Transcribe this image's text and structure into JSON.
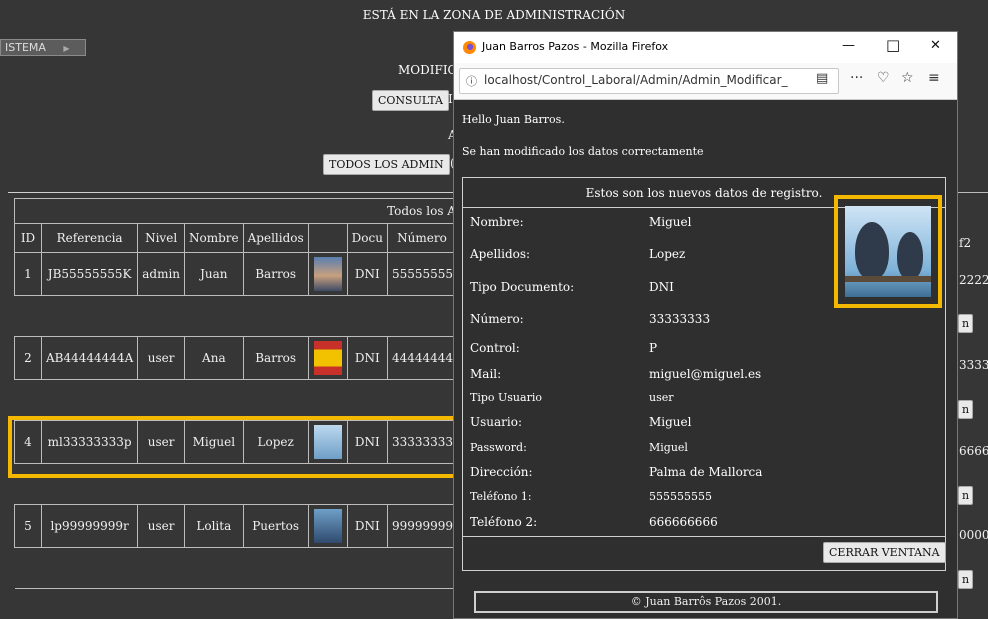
{
  "header": {
    "title": "ESTÁ EN LA ZONA DE ADMINISTRACIÓN",
    "menu_label": "ISTEMA",
    "menu_arrow": "▶",
    "modify_label": "MODIFIC",
    "consulta_button": "CONSULTA",
    "consulta_tail": "I",
    "todos_button": "TODOS LOS ADMIN",
    "todos_tail": "(",
    "side_char": "A"
  },
  "table": {
    "caption": "Todos los A",
    "columns": [
      "ID",
      "Referencia",
      "Nivel",
      "Nombre",
      "Apellidos",
      "",
      "Docu",
      "Número"
    ],
    "right_col_header": "f2",
    "rows": [
      {
        "id": "1",
        "ref": "JB55555555K",
        "nivel": "admin",
        "nombre": "Juan",
        "apellidos": "Barros",
        "doc": "DNI",
        "numero": "55555555",
        "right": "2222",
        "img": "man-photo"
      },
      {
        "id": "2",
        "ref": "AB44444444A",
        "nivel": "user",
        "nombre": "Ana",
        "apellidos": "Barros",
        "doc": "DNI",
        "numero": "44444444",
        "right": "3333",
        "img": "flag-photo"
      },
      {
        "id": "4",
        "ref": "ml33333333p",
        "nivel": "user",
        "nombre": "Miguel",
        "apellidos": "Lopez",
        "doc": "DNI",
        "numero": "33333333",
        "right": "6666",
        "img": "birds-photo"
      },
      {
        "id": "5",
        "ref": "lp99999999r",
        "nivel": "user",
        "nombre": "Lolita",
        "apellidos": "Puertos",
        "doc": "DNI",
        "numero": "99999999",
        "right": "0000",
        "img": "bird-photo"
      }
    ],
    "row_button_label": "n"
  },
  "popup": {
    "window_title": "Juan Barros Pazos - Mozilla Firefox",
    "url": "localhost/Control_Laboral/Admin/Admin_Modificar_",
    "greeting": "Hello Juan Barros.",
    "message": "Se han modificado los datos correctamente",
    "box_title": "Estos son los nuevos datos de registro.",
    "fields": [
      {
        "label": "Nombre:",
        "value": "Miguel"
      },
      {
        "label": "Apellidos:",
        "value": "Lopez"
      },
      {
        "label": "Tipo Documento:",
        "value": "DNI"
      },
      {
        "label": "Número:",
        "value": "33333333"
      },
      {
        "label": "Control:",
        "value": "P"
      },
      {
        "label": "Mail:",
        "value": "miguel@miguel.es"
      },
      {
        "label": "Tipo Usuario",
        "value": "user"
      },
      {
        "label": "Usuario:",
        "value": "Miguel"
      },
      {
        "label": "Password:",
        "value": "Miguel"
      },
      {
        "label": "Dirección:",
        "value": "Palma de Mallorca"
      },
      {
        "label": "Teléfono 1:",
        "value": "555555555"
      },
      {
        "label": "Teléfono 2:",
        "value": "666666666"
      }
    ],
    "close_button": "CERRAR VENTANA",
    "footer": "© Juan Barrôs Pazos 2001."
  },
  "colors": {
    "highlight": "#f5b800",
    "background": "#363636"
  }
}
